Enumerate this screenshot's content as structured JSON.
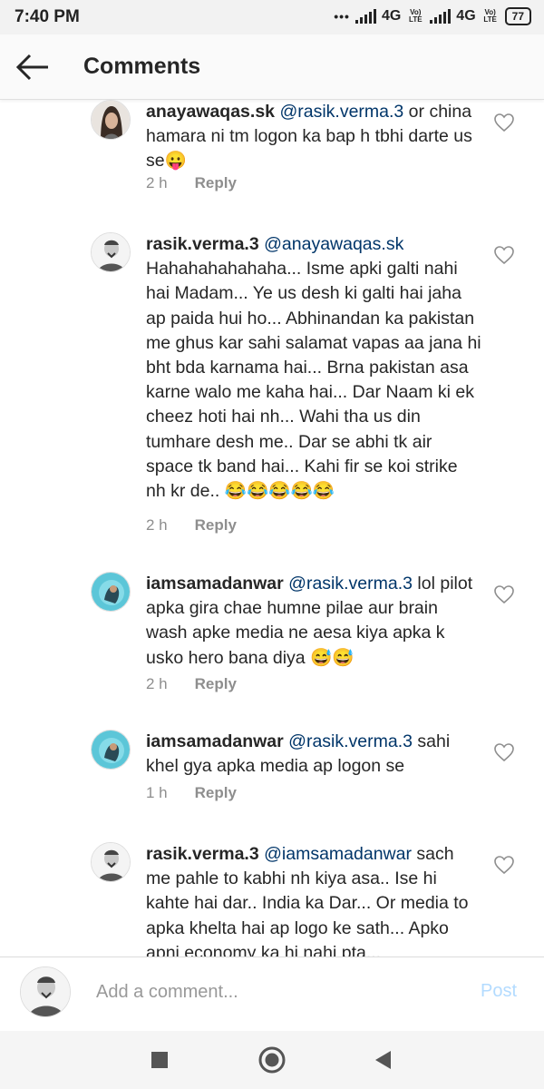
{
  "status_bar": {
    "time": "7:40 PM",
    "dots": "•••",
    "network_1": "4G",
    "network_2": "4G",
    "volte_1": "Vo) LTE",
    "volte_2": "Vo) LTE",
    "battery": "77"
  },
  "header": {
    "title": "Comments",
    "back_icon": "arrow-left-icon"
  },
  "comments": [
    {
      "username": "anayawaqas.sk",
      "mention": "@rasik.verma.3",
      "text": " or china hamara ni tm logon ka bap h tbhi darte us se😛",
      "time": "2 h",
      "reply": "Reply"
    },
    {
      "username": "rasik.verma.3",
      "mention": "@anayawaqas.sk",
      "text": " Hahahahahahaha... Isme apki galti nahi hai Madam... Ye us desh ki galti hai jaha ap paida hui ho... Abhinandan ka pakistan me ghus kar sahi salamat vapas aa jana hi bht bda karnama hai... Brna pakistan asa karne walo me kaha hai... Dar Naam ki ek cheez hoti hai nh... Wahi tha us din tumhare desh me.. Dar se abhi tk air space tk band hai... Kahi fir se koi strike nh kr de.. 😂😂😂😂😂",
      "time": "2 h",
      "reply": "Reply"
    },
    {
      "username": "iamsamadanwar",
      "mention": "@rasik.verma.3",
      "text": " lol pilot apka gira chae humne pilae aur brain wash apke media ne aesa kiya apka k usko hero bana diya 😅😅",
      "time": "2 h",
      "reply": "Reply"
    },
    {
      "username": "iamsamadanwar",
      "mention": "@rasik.verma.3",
      "text": " sahi khel gya apka media ap logon se",
      "time": "1 h",
      "reply": "Reply"
    },
    {
      "username": "rasik.verma.3",
      "mention": "@iamsamadanwar",
      "text": " sach me pahle to kabhi nh kiya asa.. Ise hi kahte hai dar.. India ka Dar... Or media to apka khelta hai ap logo ke sath... Apko apni economy ka hi nahi pta...",
      "time": "",
      "reply": ""
    }
  ],
  "add_comment": {
    "placeholder": "Add a comment...",
    "post_label": "Post"
  },
  "colors": {
    "mention": "#003569",
    "meta": "#8e8e8e",
    "post_disabled": "#b3dbff"
  }
}
